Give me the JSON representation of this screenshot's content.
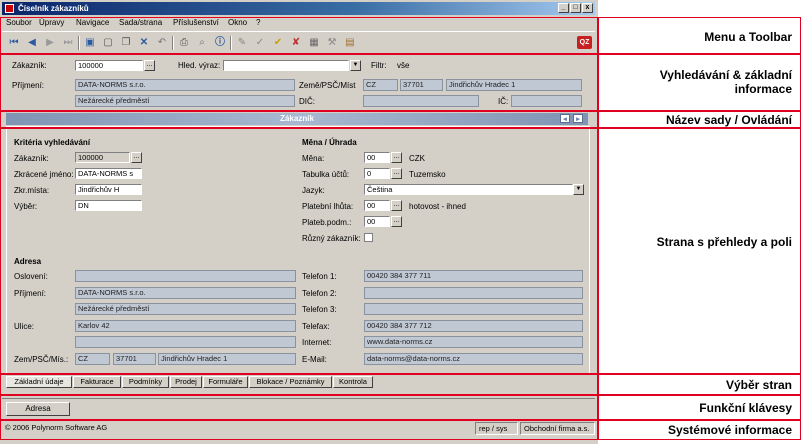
{
  "window": {
    "title": "Číselník zákazníků",
    "min": "_",
    "max": "□",
    "close": "x"
  },
  "menu": [
    "Soubor",
    "Úpravy",
    "Navigace",
    "Sada/strana",
    "Příslušenství",
    "Okno",
    "?"
  ],
  "toolbar": {
    "icons": [
      "first-icon",
      "prev-icon",
      "next-icon",
      "last-icon",
      "save-icon",
      "new-icon",
      "copy-icon",
      "delete-icon",
      "undo-icon",
      "print-icon",
      "print-preview-icon",
      "info-icon",
      "edit-icon",
      "check-icon",
      "check2-icon",
      "check3-icon",
      "calc-icon",
      "tools-icon",
      "module-icon"
    ],
    "badge": "QZ"
  },
  "search": {
    "zakaznik_label": "Zákazník:",
    "zakaznik_value": "100000",
    "hled_label": "Hled. výraz:",
    "hled_value": "",
    "filtr_label": "Filtr:",
    "filtr_value": "vše",
    "prijmeni_label": "Příjmení:",
    "prijmeni_value1": "DATA-NORMS s.r.o.",
    "prijmeni_value2": "Nežárecké předměstí",
    "zeme_label": "Země/PSČ/Míst",
    "zeme": "CZ",
    "psc": "37701",
    "misto": "Jindřichův Hradec 1",
    "dic_label": "DIČ:",
    "dic_value": "",
    "ic_label": "IČ:",
    "ic_value": ""
  },
  "section_title": "Zákazník",
  "criteria": {
    "header": "Kritéria vyhledávání",
    "rows": [
      {
        "label": "Zákazník:",
        "value": "100000"
      },
      {
        "label": "Zkrácené jméno:",
        "value": "DATA-NORMS s"
      },
      {
        "label": "Zkr.místa:",
        "value": "Jindřichův H"
      },
      {
        "label": "Výběr:",
        "value": "DN"
      }
    ]
  },
  "currency": {
    "header": "Měna / Úhrada",
    "mena_label": "Měna:",
    "mena_value": "00",
    "mena_text": "CZK",
    "tab_label": "Tabulka účtů:",
    "tab_value": "0",
    "tab_text": "Tuzemsko",
    "jazyk_label": "Jazyk:",
    "jazyk_value": "Čeština",
    "lhuta_label": "Platební lhůta:",
    "lhuta_value": "00",
    "lhuta_text": "hotovost - ihned",
    "podm_label": "Plateb.podm.:",
    "podm_value": "00",
    "ruzny_label": "Různý zákazník:"
  },
  "address": {
    "header": "Adresa",
    "osloveni_label": "Oslovení:",
    "osloveni": "",
    "prijmeni_label": "Příjmení:",
    "prijmeni1": "DATA-NORMS s.r.o.",
    "prijmeni2": "Nežárecké předměstí",
    "ulice_label": "Ulice:",
    "ulice1": "Karlov 42",
    "ulice2": "",
    "zem_label": "Zem/PSČ/Mís.:",
    "zem": "CZ",
    "psc": "37701",
    "misto": "Jindřichův Hradec 1"
  },
  "contact": {
    "rows": [
      {
        "label": "Telefon 1:",
        "value": "00420 384 377 711"
      },
      {
        "label": "Telefon 2:",
        "value": ""
      },
      {
        "label": "Telefon 3:",
        "value": ""
      },
      {
        "label": "Telefax:",
        "value": "00420 384 377 712"
      },
      {
        "label": "Internet:",
        "value": "www.data-norms.cz"
      },
      {
        "label": "E-Mail:",
        "value": "data-norms@data-norms.cz"
      }
    ]
  },
  "tabs": [
    "Základní údaje",
    "Fakturace",
    "Podmínky",
    "Prodej",
    "Formuláře",
    "Blokace / Poznámky",
    "Kontrola"
  ],
  "function_key": "Adresa",
  "status": {
    "copyright": "© 2006 Polynorm Software AG",
    "rep": "rep / sys",
    "firma": "Obchodní firma a.s."
  },
  "annotations": [
    "Menu a Toolbar",
    "Vyhledávání & základní informace",
    "Název sady / Ovládání",
    "Strana s přehledy a poli",
    "Výběr stran",
    "Funkční klávesy",
    "Systémové informace"
  ],
  "colors": {
    "accent": "#e00020",
    "title_bar": "#0a246a",
    "banner": "#8fa2c0"
  }
}
